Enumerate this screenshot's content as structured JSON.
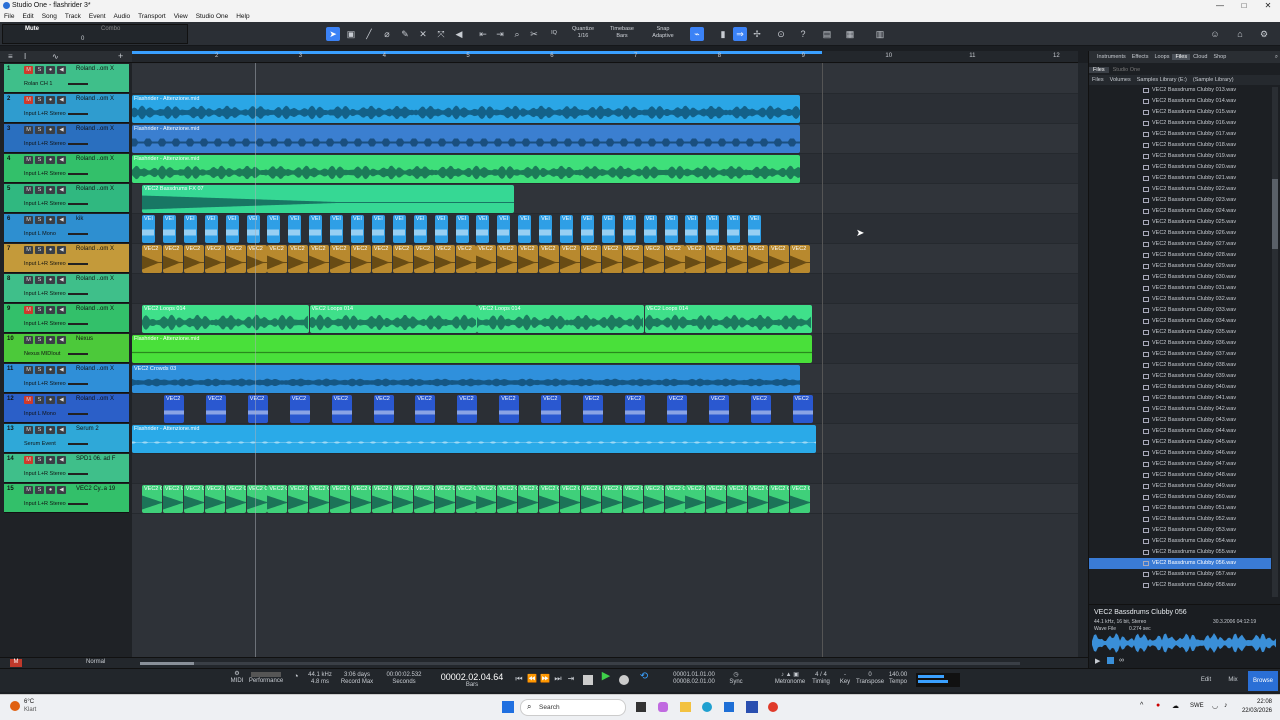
{
  "window": {
    "title": "Studio One - flashrider 3*",
    "buttons": [
      "—",
      "□",
      "✕"
    ]
  },
  "menu": [
    "File",
    "Edit",
    "Song",
    "Track",
    "Event",
    "Audio",
    "Transport",
    "View",
    "Studio One",
    "Help"
  ],
  "trackinfo": {
    "name": "Mute",
    "sub": "Combo",
    "val": "0"
  },
  "toolbar": {
    "quantize_label": "Quantize",
    "quantize_value": "1/16",
    "timebase_label": "Timebase",
    "timebase_value": "Bars",
    "snap_label": "Snap",
    "snap_value": "Adaptive",
    "iq": "IQ"
  },
  "ruler": [
    "2",
    "3",
    "4",
    "5",
    "6",
    "7",
    "8",
    "9",
    "10",
    "11",
    "12"
  ],
  "tracks": [
    {
      "n": "1",
      "name": "Roland ..om X",
      "sub": "Rolan  CH 1",
      "color": "#3fbf8a",
      "mute": true
    },
    {
      "n": "2",
      "name": "Roland ..om X",
      "sub": "Input L+R  Stereo",
      "color": "#2f9ccf",
      "mute": true
    },
    {
      "n": "3",
      "name": "Roland ..om X",
      "sub": "Input L+R  Stereo",
      "color": "#2a6fbf",
      "mute": false
    },
    {
      "n": "4",
      "name": "Roland ..om X",
      "sub": "Input L+R  Stereo",
      "color": "#33c06a",
      "mute": false
    },
    {
      "n": "5",
      "name": "Roland ..om X",
      "sub": "Input L+R  Stereo",
      "color": "#30b880",
      "mute": false
    },
    {
      "n": "6",
      "name": "kik",
      "sub": "Input L  Mono",
      "color": "#2e8fd0",
      "mute": false
    },
    {
      "n": "7",
      "name": "Roland ..om X",
      "sub": "Input L+R  Stereo",
      "color": "#c49a3a",
      "mute": false
    },
    {
      "n": "8",
      "name": "Roland ..om X",
      "sub": "Input L+R  Stereo",
      "color": "#3fbf8a",
      "mute": false
    },
    {
      "n": "9",
      "name": "Roland ..om X",
      "sub": "Input L+R  Stereo",
      "color": "#33c06a",
      "mute": true
    },
    {
      "n": "10",
      "name": "Nexus",
      "sub": "Nexus  MIDIout",
      "color": "#4cc93a",
      "mute": false
    },
    {
      "n": "11",
      "name": "Roland ..om X",
      "sub": "Input L+R  Stereo",
      "color": "#2f8fd8",
      "mute": false
    },
    {
      "n": "12",
      "name": "Roland ..om X",
      "sub": "Input L  Mono",
      "color": "#2b5fc8",
      "mute": true
    },
    {
      "n": "13",
      "name": "Serum 2",
      "sub": "Serum  Event",
      "color": "#2fa8d8",
      "mute": false
    },
    {
      "n": "14",
      "name": "SPD1 06. ad F",
      "sub": "Input L+R  Stereo",
      "color": "#3fbf8a",
      "mute": true
    },
    {
      "n": "15",
      "name": "VEC2 Cy..a 19",
      "sub": "Input L+R  Stereo",
      "color": "#33c06a",
      "mute": false
    }
  ],
  "clips": {
    "c2": "Flashrider - Attenzione.mid",
    "c3": "Flashrider - Attenzione.mid",
    "c4": "Flashrider - Attenzione.mid",
    "c5": "VEC2 Bassdrums FX 07",
    "c6": "VEI",
    "c7": "VEC2",
    "c9": "VEC2 Loops 014",
    "c10": "Flashrider - Attenzione.mid",
    "c11": "VEC2 Crowds 03",
    "c12": "VEC2",
    "c13": "Flashrider - Attenzione.mid",
    "c15": "VEC2 C"
  },
  "browser": {
    "tabs": [
      "Instruments",
      "Effects",
      "Loops",
      "Files",
      "Cloud",
      "Shop"
    ],
    "subtabs": [
      "Files",
      "Studio One"
    ],
    "crumbs": [
      "Files",
      "Volumes",
      "Samples Library (E:)",
      "(Sample Library)"
    ],
    "files": [
      "VEC2 Bassdrums Clubby 013.wav",
      "VEC2 Bassdrums Clubby 014.wav",
      "VEC2 Bassdrums Clubby 015.wav",
      "VEC2 Bassdrums Clubby 016.wav",
      "VEC2 Bassdrums Clubby 017.wav",
      "VEC2 Bassdrums Clubby 018.wav",
      "VEC2 Bassdrums Clubby 019.wav",
      "VEC2 Bassdrums Clubby 020.wav",
      "VEC2 Bassdrums Clubby 021.wav",
      "VEC2 Bassdrums Clubby 022.wav",
      "VEC2 Bassdrums Clubby 023.wav",
      "VEC2 Bassdrums Clubby 024.wav",
      "VEC2 Bassdrums Clubby 025.wav",
      "VEC2 Bassdrums Clubby 026.wav",
      "VEC2 Bassdrums Clubby 027.wav",
      "VEC2 Bassdrums Clubby 028.wav",
      "VEC2 Bassdrums Clubby 029.wav",
      "VEC2 Bassdrums Clubby 030.wav",
      "VEC2 Bassdrums Clubby 031.wav",
      "VEC2 Bassdrums Clubby 032.wav",
      "VEC2 Bassdrums Clubby 033.wav",
      "VEC2 Bassdrums Clubby 034.wav",
      "VEC2 Bassdrums Clubby 035.wav",
      "VEC2 Bassdrums Clubby 036.wav",
      "VEC2 Bassdrums Clubby 037.wav",
      "VEC2 Bassdrums Clubby 038.wav",
      "VEC2 Bassdrums Clubby 039.wav",
      "VEC2 Bassdrums Clubby 040.wav",
      "VEC2 Bassdrums Clubby 041.wav",
      "VEC2 Bassdrums Clubby 042.wav",
      "VEC2 Bassdrums Clubby 043.wav",
      "VEC2 Bassdrums Clubby 044.wav",
      "VEC2 Bassdrums Clubby 045.wav",
      "VEC2 Bassdrums Clubby 046.wav",
      "VEC2 Bassdrums Clubby 047.wav",
      "VEC2 Bassdrums Clubby 048.wav",
      "VEC2 Bassdrums Clubby 049.wav",
      "VEC2 Bassdrums Clubby 050.wav",
      "VEC2 Bassdrums Clubby 051.wav",
      "VEC2 Bassdrums Clubby 052.wav",
      "VEC2 Bassdrums Clubby 053.wav",
      "VEC2 Bassdrums Clubby 054.wav",
      "VEC2 Bassdrums Clubby 055.wav",
      "VEC2 Bassdrums Clubby 056.wav",
      "VEC2 Bassdrums Clubby 057.wav",
      "VEC2 Bassdrums Clubby 058.wav"
    ],
    "selected": "VEC2 Bassdrums Clubby 056.wav",
    "info_name": "VEC2 Bassdrums Clubby 056",
    "info_format": "44.1 kHz, 16 bit, Stereo",
    "info_date": "30.3.2006 04:12:19",
    "info_type": "Wave File",
    "info_len": "0.274 sec"
  },
  "transport": {
    "midi": "MIDI",
    "performance": "Performance",
    "samplerate": "44.1 kHz",
    "latency": "4.8 ms",
    "rec_days": "3:06 days",
    "rec_label": "Record Max",
    "seconds": "00:00:02.532",
    "seconds_label": "Seconds",
    "bars": "00002.02.04.64",
    "bars_label": "Bars",
    "loop_start": "00001.01.01.00",
    "loop_end": "00008.02.01.00",
    "sync": "Sync",
    "metronome": "Metronome",
    "timing": "Timing",
    "sig": "4 / 4",
    "key": "Key",
    "transpose": "0",
    "transpose_label": "Transpose",
    "tempo": "140.00",
    "tempo_label": "Tempo",
    "edit": "Edit",
    "mix": "Mix",
    "browse": "Browse"
  },
  "taskbar": {
    "weather_temp": "6°C",
    "weather_text": "Klart",
    "search": "Search",
    "lang": "SWE",
    "time": "22:08",
    "date": "22/03/2026"
  },
  "status": {
    "mode": "Normal"
  }
}
